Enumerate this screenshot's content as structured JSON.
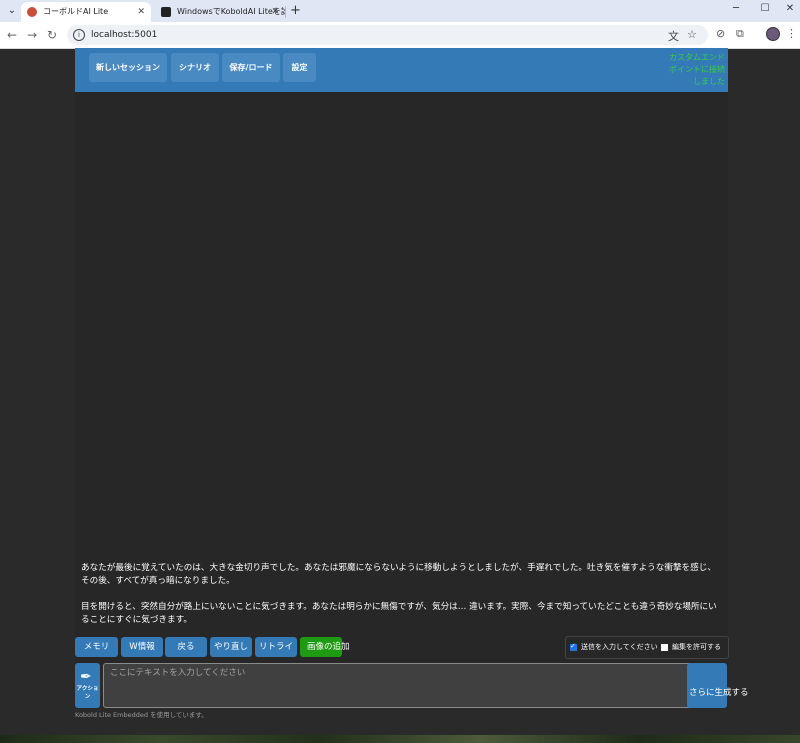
{
  "browser": {
    "tabs": [
      {
        "title": "コーボルドAI Lite",
        "active": true
      },
      {
        "title": "WindowsでKoboldAI Liteを試してみ…",
        "active": false
      }
    ],
    "url": "localhost:5001"
  },
  "app": {
    "nav": {
      "new_session": "新しいセッション",
      "scenario": "シナリオ",
      "save_load": "保存/ロード",
      "settings": "設定"
    },
    "connection_status": "カスタムエンドポイントに接続しました",
    "story": [
      "あなたが最後に覚えていたのは、大きな金切り声でした。あなたは邪魔にならないように移動しようとしましたが、手遅れでした。吐き気を催すような衝撃を感じ、その後、すべてが真っ暗になりました。",
      "目を開けると、突然自分が路上にいないことに気づきます。あなたは明らかに無傷ですが、気分は… 違います。実際、今まで知っていたどことも違う奇妙な場所にいることにすぐに気づきます。"
    ],
    "buttons": {
      "memory": "メモリ",
      "winfo": "W情報",
      "back": "戻る",
      "redo": "やり直し",
      "retry": "リトライ",
      "add_image": "画像の追加"
    },
    "options": {
      "enter_send": "送信を入力してください",
      "enter_send_checked": true,
      "allow_edit": "編集を許可する",
      "allow_edit_checked": false
    },
    "action_label": "アクション",
    "input_placeholder": "ここにテキストを入力してください",
    "generate_label": "さらに生成する",
    "footer": "Kobold Lite Embedded を使用しています。"
  },
  "colors": {
    "accent": "#337ab7",
    "status_green": "#37d03c",
    "image_button": "#1f9a13",
    "background": "#272727"
  }
}
